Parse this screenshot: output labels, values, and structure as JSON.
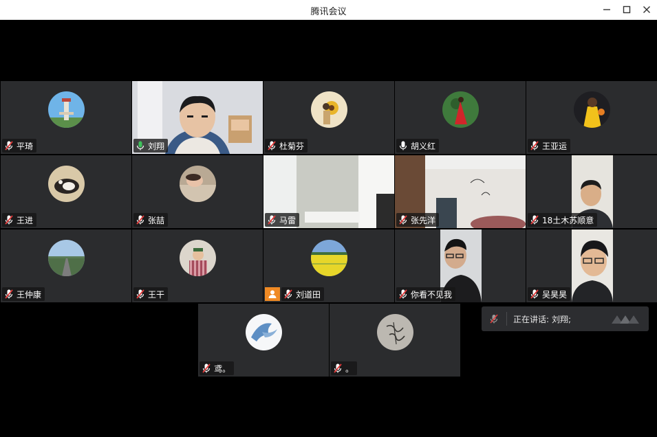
{
  "window": {
    "title": "腾讯会议"
  },
  "participants": [
    {
      "name": "平琦",
      "mic": "muted",
      "view": "avatar",
      "avatar": "tower"
    },
    {
      "name": "刘翔",
      "mic": "active",
      "view": "video",
      "speaking": true,
      "video": "man-room"
    },
    {
      "name": "杜菊芬",
      "mic": "muted",
      "view": "avatar",
      "avatar": "sunflower"
    },
    {
      "name": "胡义红",
      "mic": "unmuted",
      "view": "avatar",
      "avatar": "red-dress"
    },
    {
      "name": "王亚运",
      "mic": "muted",
      "view": "avatar",
      "avatar": "basketball"
    },
    {
      "name": "王进",
      "mic": "muted",
      "view": "avatar",
      "avatar": "cat"
    },
    {
      "name": "张喆",
      "mic": "muted",
      "view": "avatar",
      "avatar": "sleeping-baby"
    },
    {
      "name": "马雷",
      "mic": "muted",
      "view": "video",
      "video": "office-corner"
    },
    {
      "name": "张先洋",
      "mic": "muted",
      "view": "video",
      "video": "bedroom"
    },
    {
      "name": "18土木苏顺意",
      "mic": "muted",
      "view": "video",
      "video": "young-man"
    },
    {
      "name": "王仲康",
      "mic": "muted",
      "view": "avatar",
      "avatar": "road"
    },
    {
      "name": "王干",
      "mic": "muted",
      "view": "avatar",
      "avatar": "child"
    },
    {
      "name": "刘道田",
      "mic": "muted",
      "view": "avatar",
      "avatar": "flower-field",
      "user_icon": true
    },
    {
      "name": "你看不见我",
      "mic": "muted",
      "view": "video",
      "video": "glasses-dark"
    },
    {
      "name": "吴昊昊",
      "mic": "muted",
      "view": "video",
      "video": "glasses-man"
    },
    {
      "name": "鸢。",
      "mic": "muted",
      "view": "avatar",
      "avatar": "dove"
    },
    {
      "name": "。",
      "mic": "muted",
      "view": "avatar",
      "avatar": "calligraphy"
    }
  ],
  "speaking_panel": {
    "prefix": "正在讲话:",
    "names": "刘翔;"
  },
  "icons": {
    "mic_muted": "mic-muted-icon",
    "mic_active": "mic-active-icon",
    "mic_unmuted": "mic-icon",
    "user": "user-icon",
    "minimize": "minimize-icon",
    "maximize": "maximize-icon",
    "close": "close-icon"
  },
  "colors": {
    "tile": "#2b2c2e",
    "speaking_border": "#3aa64a",
    "mute_red": "#e33b3b",
    "active_green": "#3ec25b",
    "user_orange": "#f08a24"
  }
}
